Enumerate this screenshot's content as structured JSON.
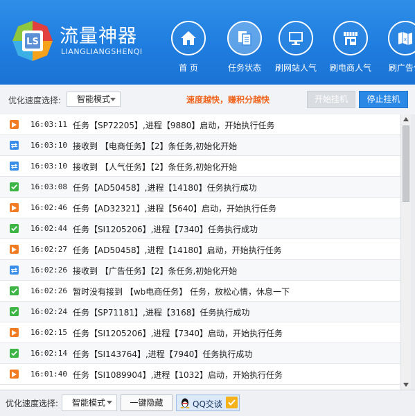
{
  "brand": {
    "logo_letters": "LS",
    "title": "流量神器",
    "subtitle": "LIANGLIANGSHENQI"
  },
  "nav": {
    "home": {
      "label": "首 页",
      "icon": "home-icon"
    },
    "task": {
      "label": "任务状态",
      "icon": "documents-icon"
    },
    "site": {
      "label": "刷网站人气",
      "icon": "monitor-icon"
    },
    "shop": {
      "label": "刷电商人气",
      "icon": "storefront-icon"
    },
    "ad": {
      "label": "刷广告优",
      "icon": "map-icon"
    }
  },
  "toolbar": {
    "speed_label": "优化速度选择:",
    "mode_value": "智能模式",
    "slogan": "速度越快，赚积分越快",
    "start_label": "开始挂机",
    "stop_label": "停止挂机"
  },
  "log": [
    {
      "type": "play",
      "time": "16:03:11",
      "message": "任务【SP72205】,进程【9880】启动，开始执行任务"
    },
    {
      "type": "recv",
      "time": "16:03:10",
      "message": "接收到 【电商任务】【2】条任务,初始化开始"
    },
    {
      "type": "recv",
      "time": "16:03:10",
      "message": "接收到 【人气任务】【2】条任务,初始化开始"
    },
    {
      "type": "ok",
      "time": "16:03:08",
      "message": "任务【AD50458】,进程【14180】任务执行成功"
    },
    {
      "type": "play",
      "time": "16:02:46",
      "message": "任务【AD32321】,进程【5640】启动，开始执行任务"
    },
    {
      "type": "ok",
      "time": "16:02:44",
      "message": "任务【SI1205206】,进程【7340】任务执行成功"
    },
    {
      "type": "play",
      "time": "16:02:27",
      "message": "任务【AD50458】,进程【14180】启动，开始执行任务"
    },
    {
      "type": "recv",
      "time": "16:02:26",
      "message": "接收到 【广告任务】【2】条任务,初始化开始"
    },
    {
      "type": "ok",
      "time": "16:02:26",
      "message": "暂时没有接到 【wb电商任务】 任务，放松心情，休息一下"
    },
    {
      "type": "ok",
      "time": "16:02:24",
      "message": "任务【SP71181】,进程【3168】任务执行成功"
    },
    {
      "type": "play",
      "time": "16:02:15",
      "message": "任务【SI1205206】,进程【7340】启动，开始执行任务"
    },
    {
      "type": "ok",
      "time": "16:02:14",
      "message": "任务【SI143764】,进程【7940】任务执行成功"
    },
    {
      "type": "play",
      "time": "16:01:40",
      "message": "任务【SI1089904】,进程【1032】启动，开始执行任务"
    }
  ],
  "bottom": {
    "speed_label": "优化速度选择:",
    "mode_value": "智能模式",
    "hide_label": "一键隐藏",
    "qq_label": "QQ交谈"
  },
  "colors": {
    "header_blue": "#1f7ddf",
    "slogan_orange": "#f0641e",
    "stop_button": "#2b88e5",
    "icon_play": "#f07b22",
    "icon_recv": "#3a8ee8",
    "icon_ok": "#3cb544"
  }
}
